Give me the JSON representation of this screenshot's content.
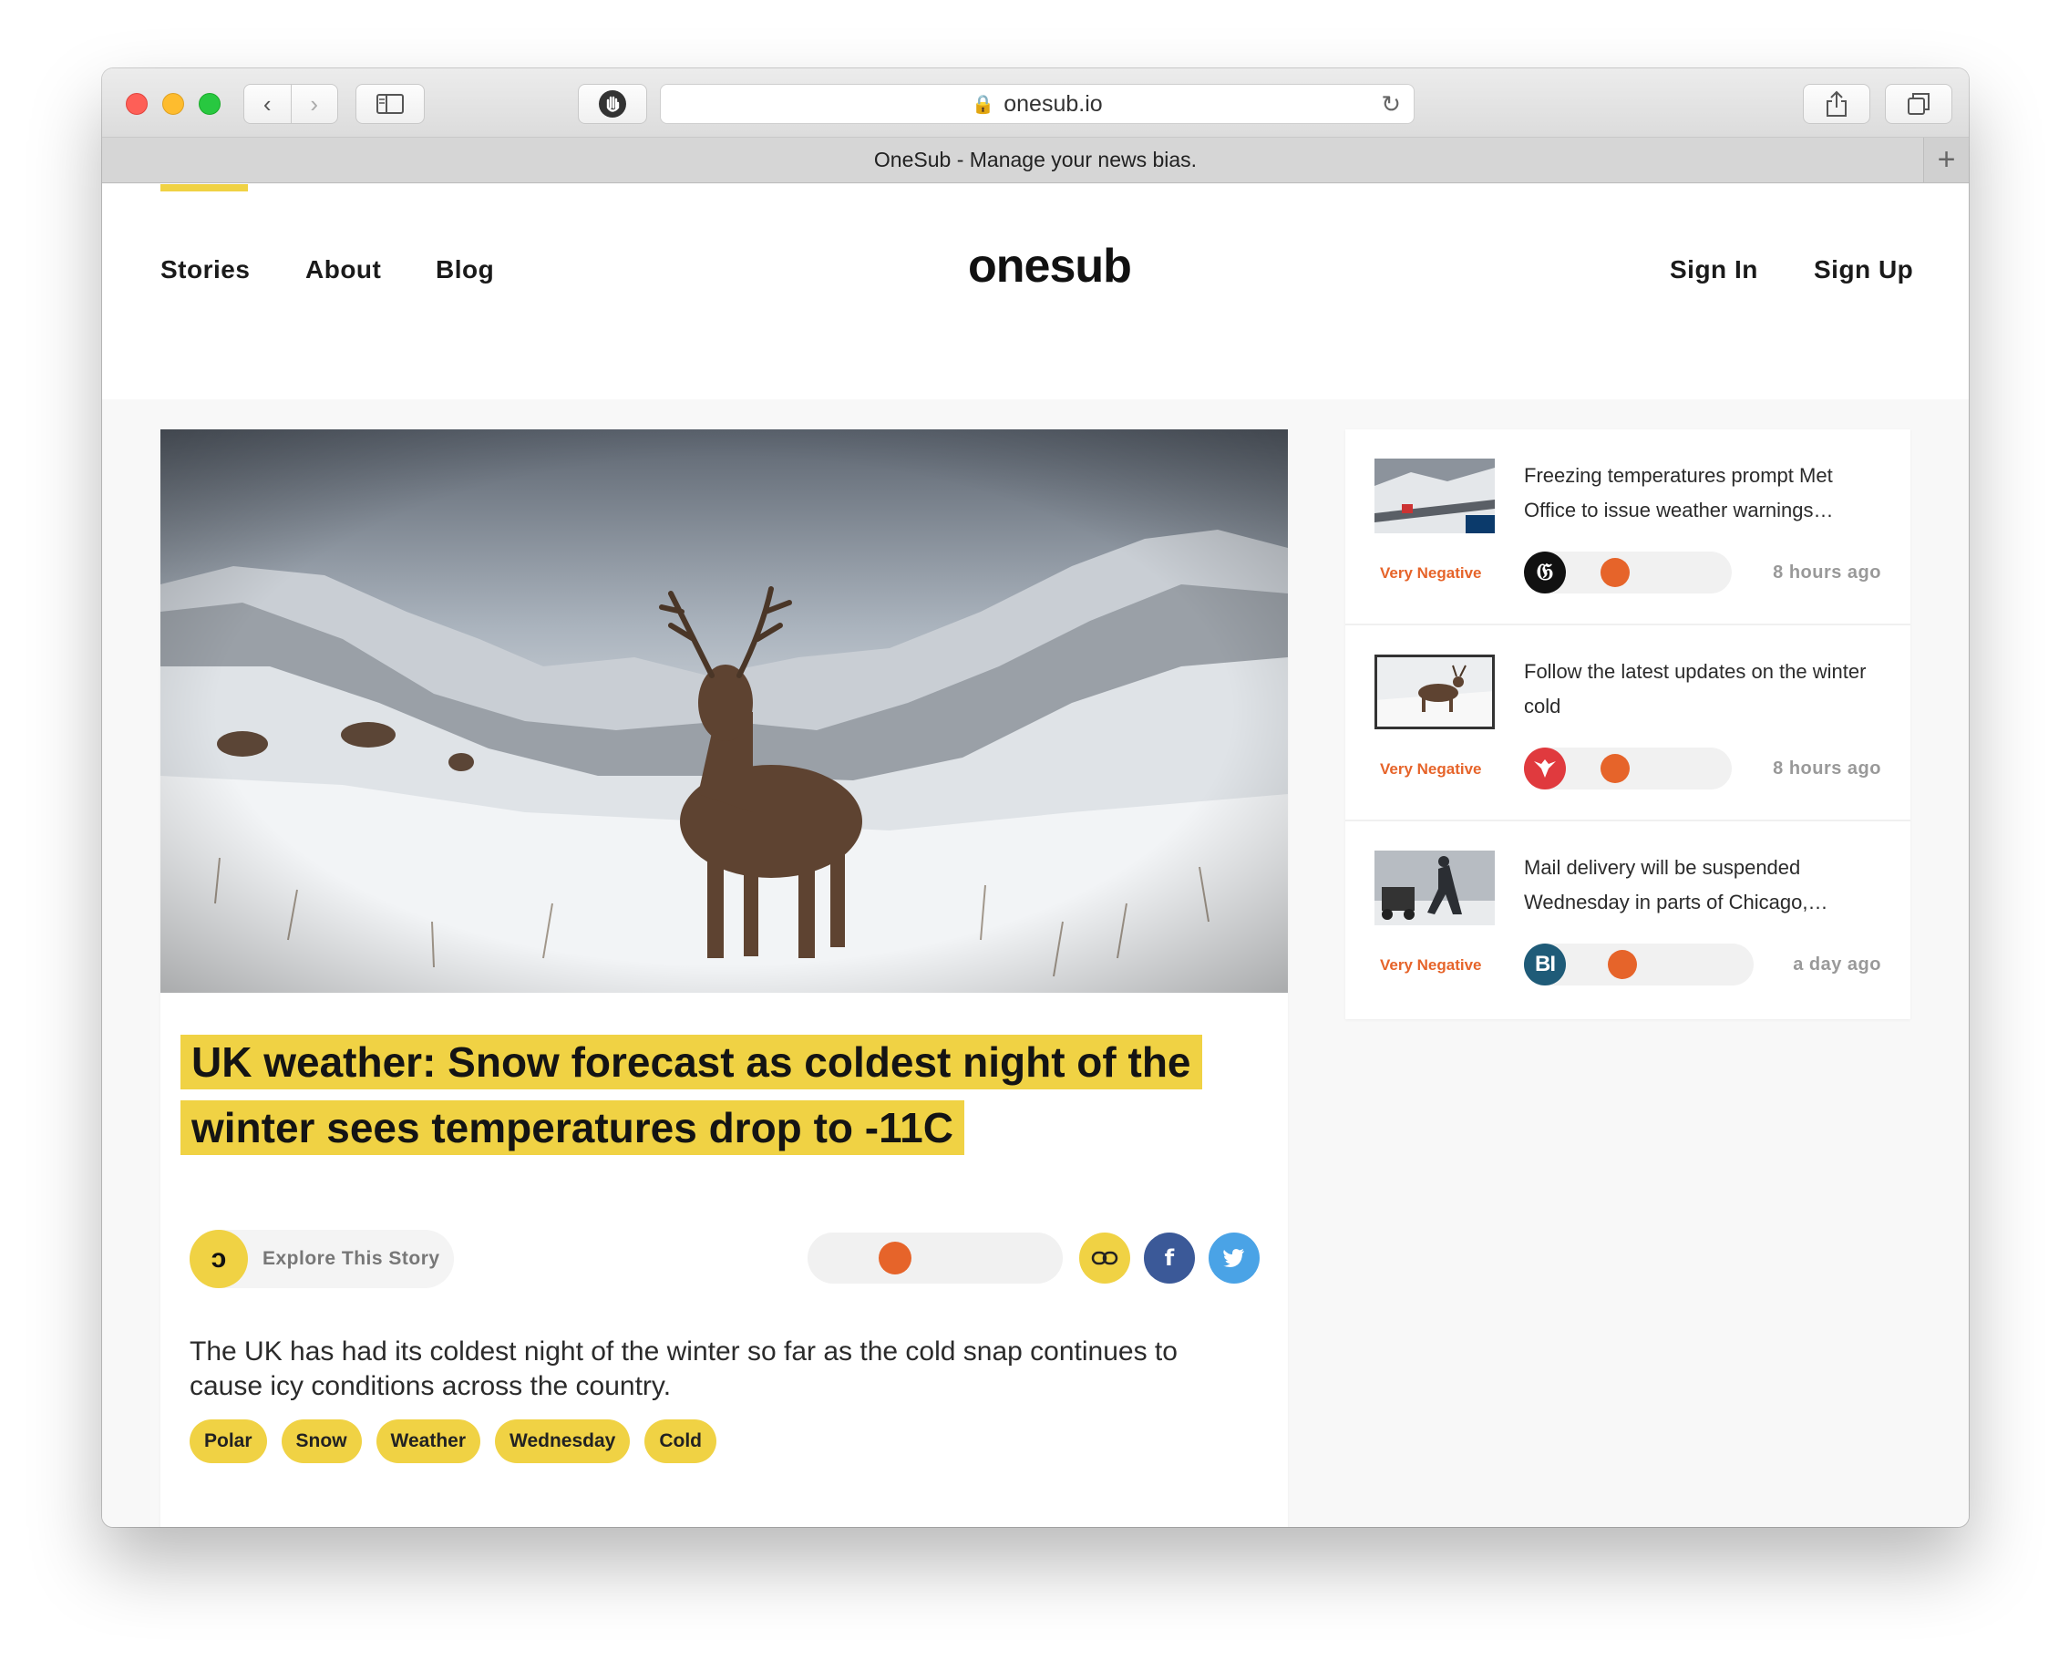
{
  "browser": {
    "url": "onesub.io",
    "tab_title": "OneSub - Manage your news bias."
  },
  "header": {
    "nav": [
      "Stories",
      "About",
      "Blog"
    ],
    "logo": "onesub",
    "auth": [
      "Sign In",
      "Sign Up"
    ]
  },
  "article": {
    "headline": "UK weather: Snow forecast as coldest night of the winter sees temperatures drop to -11C",
    "explore_label": "Explore This Story",
    "sentiment_level": 0.3,
    "summary": "The UK has had its coldest night of the winter so far as the cold snap continues to cause icy conditions across the country.",
    "tags": [
      "Polar",
      "Snow",
      "Weather",
      "Wednesday",
      "Cold"
    ]
  },
  "related": [
    {
      "title": "Freezing temperatures prompt Met Office to issue weather warnings…",
      "sentiment": "Very Negative",
      "source": "The Guardian",
      "source_glyph": "G",
      "sentiment_level": 0.3,
      "time": "8 hours ago"
    },
    {
      "title": "Follow the latest updates on the winter cold",
      "sentiment": "Very Negative",
      "source": "The Independent",
      "source_glyph": "eagle",
      "sentiment_level": 0.3,
      "time": "8 hours ago"
    },
    {
      "title": "Mail delivery will be suspended Wednesday in parts of Chicago,…",
      "sentiment": "Very Negative",
      "source": "Business Insider",
      "source_glyph": "BI",
      "sentiment_level": 0.3,
      "time": "a day ago"
    }
  ],
  "colors": {
    "accent_yellow": "#f0d244",
    "negative_orange": "#e6642a",
    "facebook": "#3b5998",
    "twitter": "#4aa3e6"
  }
}
